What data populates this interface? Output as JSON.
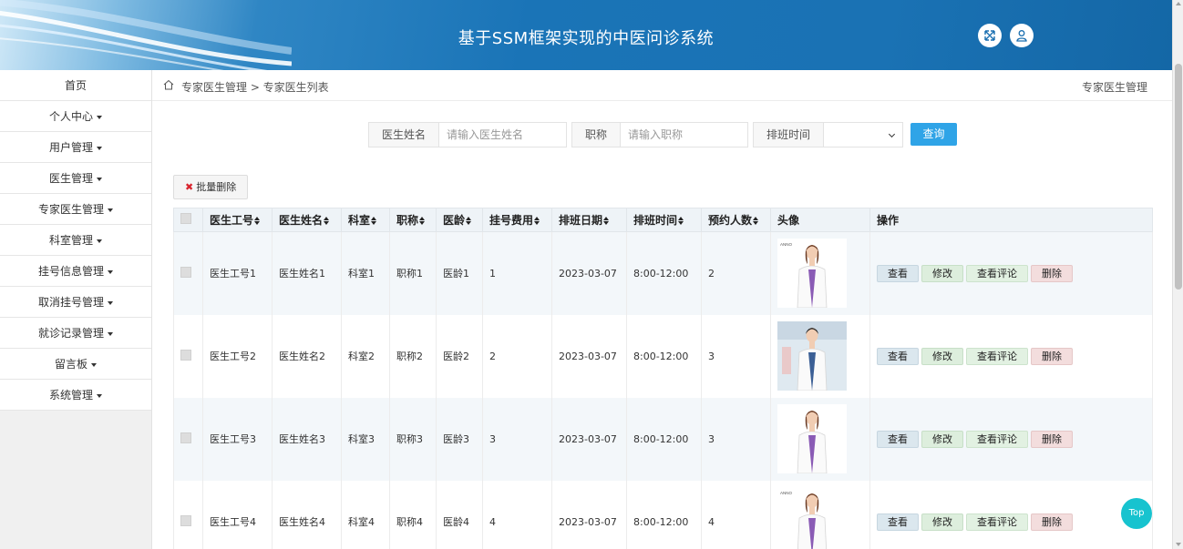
{
  "header": {
    "title": "基于SSM框架实现的中医问诊系统"
  },
  "sidebar": {
    "items": [
      {
        "label": "首页",
        "dropdown": false
      },
      {
        "label": "个人中心",
        "dropdown": true
      },
      {
        "label": "用户管理",
        "dropdown": true
      },
      {
        "label": "医生管理",
        "dropdown": true
      },
      {
        "label": "专家医生管理",
        "dropdown": true
      },
      {
        "label": "科室管理",
        "dropdown": true
      },
      {
        "label": "挂号信息管理",
        "dropdown": true
      },
      {
        "label": "取消挂号管理",
        "dropdown": true
      },
      {
        "label": "就诊记录管理",
        "dropdown": true
      },
      {
        "label": "留言板",
        "dropdown": true
      },
      {
        "label": "系统管理",
        "dropdown": true
      }
    ]
  },
  "breadcrumb": {
    "path": "专家医生管理 > 专家医生列表",
    "right": "专家医生管理"
  },
  "search": {
    "name_label": "医生姓名",
    "name_placeholder": "请输入医生姓名",
    "title_label": "职称",
    "title_placeholder": "请输入职称",
    "time_label": "排班时间",
    "time_value": "",
    "query_label": "查询"
  },
  "batch_delete_label": "批量删除",
  "table": {
    "headers": [
      "医生工号",
      "医生姓名",
      "科室",
      "职称",
      "医龄",
      "挂号费用",
      "排班日期",
      "排班时间",
      "预约人数",
      "头像",
      "操作"
    ],
    "actions": {
      "view": "查看",
      "edit": "修改",
      "comments": "查看评论",
      "delete": "删除"
    },
    "rows": [
      {
        "id": "医生工号1",
        "name": "医生姓名1",
        "dept": "科室1",
        "title": "职称1",
        "age": "医龄1",
        "fee": "1",
        "date": "2023-03-07",
        "time": "8:00-12:00",
        "count": "2",
        "avatar": "female-doctor"
      },
      {
        "id": "医生工号2",
        "name": "医生姓名2",
        "dept": "科室2",
        "title": "职称2",
        "age": "医龄2",
        "fee": "2",
        "date": "2023-03-07",
        "time": "8:00-12:00",
        "count": "3",
        "avatar": "male-doctor"
      },
      {
        "id": "医生工号3",
        "name": "医生姓名3",
        "dept": "科室3",
        "title": "职称3",
        "age": "医龄3",
        "fee": "3",
        "date": "2023-03-07",
        "time": "8:00-12:00",
        "count": "3",
        "avatar": "female-doctor-2"
      },
      {
        "id": "医生工号4",
        "name": "医生姓名4",
        "dept": "科室4",
        "title": "职称4",
        "age": "医龄4",
        "fee": "4",
        "date": "2023-03-07",
        "time": "8:00-12:00",
        "count": "4",
        "avatar": "female-doctor"
      }
    ]
  },
  "top_button_label": "Top"
}
